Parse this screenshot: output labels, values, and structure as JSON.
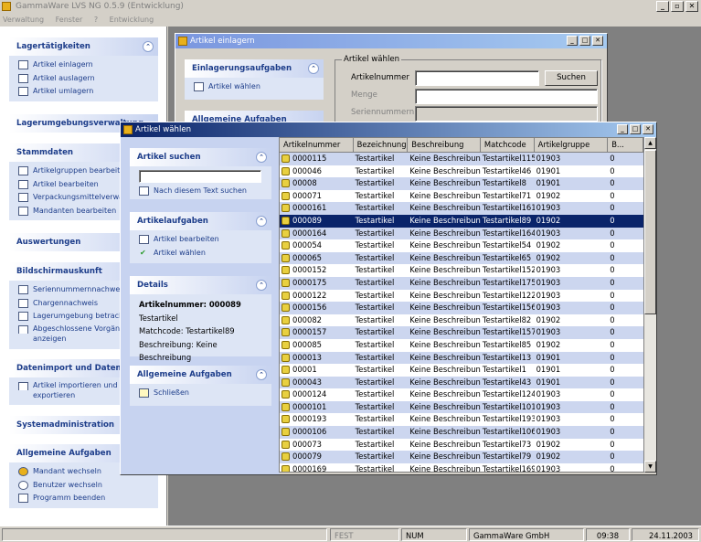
{
  "app": {
    "title": "GammaWare LVS NG 0.5.9 (Entwicklung)",
    "minimize": "_",
    "maximize": "▫",
    "close": "✕"
  },
  "menu": [
    "Verwaltung",
    "Fenster",
    "?",
    "Entwicklung"
  ],
  "sidebar": {
    "lager": {
      "title": "Lagertätigkeiten",
      "items": [
        "Artikel einlagern",
        "Artikel auslagern",
        "Artikel umlagern"
      ]
    },
    "umgebung": {
      "title": "Lagerumgebungsverwaltung"
    },
    "stamm": {
      "title": "Stammdaten",
      "items": [
        "Artikelgruppen bearbeiten",
        "Artikel bearbeiten",
        "Verpackungsmittelverwaltung",
        "Mandanten bearbeiten"
      ]
    },
    "auswertungen": {
      "title": "Auswertungen"
    },
    "bildschirm": {
      "title": "Bildschirmauskunft",
      "items": [
        "Seriennummernnachweis",
        "Chargennachweis",
        "Lagerumgebung betrachten",
        "Abgeschlossene Vorgänge",
        "anzeigen"
      ]
    },
    "datenimport": {
      "title": "Datenimport und Datenexport",
      "items": [
        "Artikel importieren und",
        "exportieren"
      ]
    },
    "sysadmin": {
      "title": "Systemadministration"
    },
    "allgemein": {
      "title": "Allgemeine Aufgaben",
      "items": [
        "Mandant wechseln",
        "Benutzer wechseln",
        "Programm beenden"
      ]
    }
  },
  "einlagern": {
    "title": "Artikel einlagern",
    "panel1": {
      "title": "Einlagerungsaufgaben",
      "item": "Artikel wählen"
    },
    "panel2": {
      "title": "Allgemeine Aufgaben"
    },
    "group": "Artikel wählen",
    "artikelnummer_label": "Artikelnummer",
    "menge_label": "Menge",
    "serien_label": "Seriennummern",
    "search_button": "Suchen"
  },
  "dialog": {
    "title": "Artikel wählen",
    "suchen": {
      "title": "Artikel suchen",
      "link": "Nach diesem Text suchen",
      "placeholder": ""
    },
    "aufgaben": {
      "title": "Artikelaufgaben",
      "items": [
        "Artikel bearbeiten",
        "Artikel wählen"
      ]
    },
    "details": {
      "title": "Details",
      "artikelnummer": "Artikelnummer: 000089",
      "bezeichnung": "Testartikel",
      "matchcode": "Matchcode: Testartikel89",
      "beschreibung": "Beschreibung: Keine Beschreibung"
    },
    "allgemein": {
      "title": "Allgemeine Aufgaben",
      "item": "Schließen"
    },
    "columns": [
      "Artikelnummer",
      "Bezeichnung",
      "Beschreibung",
      "Matchcode",
      "Artikelgruppe",
      "B..."
    ],
    "rows": [
      [
        "0000115",
        "Testartikel",
        "Keine Beschreibung",
        "Testartikel115",
        "01903",
        "0"
      ],
      [
        "000046",
        "Testartikel",
        "Keine Beschreibung",
        "Testartikel46",
        "01901",
        "0"
      ],
      [
        "00008",
        "Testartikel",
        "Keine Beschreibung",
        "Testartikel8",
        "01901",
        "0"
      ],
      [
        "000071",
        "Testartikel",
        "Keine Beschreibung",
        "Testartikel71",
        "01902",
        "0"
      ],
      [
        "0000161",
        "Testartikel",
        "Keine Beschreibung",
        "Testartikel161",
        "01903",
        "0"
      ],
      [
        "000089",
        "Testartikel",
        "Keine Beschreibung",
        "Testartikel89",
        "01902",
        "0"
      ],
      [
        "0000164",
        "Testartikel",
        "Keine Beschreibung",
        "Testartikel164",
        "01903",
        "0"
      ],
      [
        "000054",
        "Testartikel",
        "Keine Beschreibung",
        "Testartikel54",
        "01902",
        "0"
      ],
      [
        "000065",
        "Testartikel",
        "Keine Beschreibung",
        "Testartikel65",
        "01902",
        "0"
      ],
      [
        "0000152",
        "Testartikel",
        "Keine Beschreibung",
        "Testartikel152",
        "01903",
        "0"
      ],
      [
        "0000175",
        "Testartikel",
        "Keine Beschreibung",
        "Testartikel175",
        "01903",
        "0"
      ],
      [
        "0000122",
        "Testartikel",
        "Keine Beschreibung",
        "Testartikel122",
        "01903",
        "0"
      ],
      [
        "0000156",
        "Testartikel",
        "Keine Beschreibung",
        "Testartikel156",
        "01903",
        "0"
      ],
      [
        "000082",
        "Testartikel",
        "Keine Beschreibung",
        "Testartikel82",
        "01902",
        "0"
      ],
      [
        "0000157",
        "Testartikel",
        "Keine Beschreibung",
        "Testartikel157",
        "01903",
        "0"
      ],
      [
        "000085",
        "Testartikel",
        "Keine Beschreibung",
        "Testartikel85",
        "01902",
        "0"
      ],
      [
        "000013",
        "Testartikel",
        "Keine Beschreibung",
        "Testartikel13",
        "01901",
        "0"
      ],
      [
        "00001",
        "Testartikel",
        "Keine Beschreibung",
        "Testartikel1",
        "01901",
        "0"
      ],
      [
        "000043",
        "Testartikel",
        "Keine Beschreibung",
        "Testartikel43",
        "01901",
        "0"
      ],
      [
        "0000124",
        "Testartikel",
        "Keine Beschreibung",
        "Testartikel124",
        "01903",
        "0"
      ],
      [
        "0000101",
        "Testartikel",
        "Keine Beschreibung",
        "Testartikel101",
        "01903",
        "0"
      ],
      [
        "0000193",
        "Testartikel",
        "Keine Beschreibung",
        "Testartikel193",
        "01903",
        "0"
      ],
      [
        "0000106",
        "Testartikel",
        "Keine Beschreibung",
        "Testartikel106",
        "01903",
        "0"
      ],
      [
        "000073",
        "Testartikel",
        "Keine Beschreibung",
        "Testartikel73",
        "01902",
        "0"
      ],
      [
        "000079",
        "Testartikel",
        "Keine Beschreibung",
        "Testartikel79",
        "01902",
        "0"
      ],
      [
        "0000169",
        "Testartikel",
        "Keine Beschreibung",
        "Testartikel169",
        "01903",
        "0"
      ]
    ],
    "selected_row": 5
  },
  "status": {
    "fest": "FEST",
    "num": "NUM",
    "company": "GammaWare GmbH",
    "time": "09:38",
    "date": "24.11.2003"
  },
  "colors": {
    "selection": "#0a246a",
    "alt_row": "#ccd6ef",
    "title_active": "#0a246a",
    "title_inactive": "#7a96df",
    "panel_header": "#1d3d8a"
  }
}
